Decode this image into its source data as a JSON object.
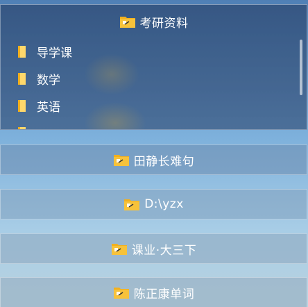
{
  "panels": [
    {
      "title": "考研资料",
      "expanded": true,
      "items": [
        {
          "label": "导学课"
        },
        {
          "label": "数学"
        },
        {
          "label": "英语"
        }
      ]
    },
    {
      "title": "田静长难句",
      "expanded": false
    },
    {
      "title": "D:\\yzx",
      "expanded": false
    },
    {
      "title": "课业·大三下",
      "expanded": false
    },
    {
      "title": "陈正康单词",
      "expanded": false
    }
  ],
  "icons": {
    "folder": "folder-shortcut-icon",
    "file": "folder-icon"
  },
  "colors": {
    "folder": "#f2b01e",
    "folder_light": "#ffd86b",
    "text": "#ffffff"
  }
}
